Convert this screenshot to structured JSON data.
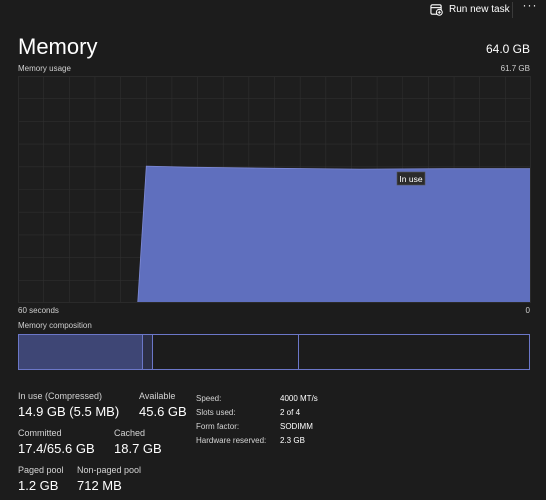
{
  "toolbar": {
    "run_task_label": "Run new task",
    "more_label": "···"
  },
  "header": {
    "title": "Memory",
    "total": "64.0 GB",
    "chart_label": "Memory usage",
    "chart_max": "61.7 GB"
  },
  "chart_data": {
    "type": "area",
    "title": "Memory usage",
    "xlabel": "",
    "ylabel": "",
    "x_range_labels": [
      "60 seconds",
      "0"
    ],
    "ymax_label": "61.7 GB",
    "ylim": [
      0,
      61.7
    ],
    "grid": true,
    "series": [
      {
        "name": "In use",
        "x": [
          60,
          46,
          45,
          40,
          30,
          20,
          10,
          0
        ],
        "values": [
          0,
          0,
          37.2,
          36.9,
          36.6,
          36.4,
          36.5,
          36.5
        ],
        "color": "#5f6fbe"
      }
    ],
    "tooltip": "In use"
  },
  "axis": {
    "left": "60 seconds",
    "right": "0"
  },
  "composition": {
    "label": "Memory composition"
  },
  "stats": {
    "in_use_label": "In use (Compressed)",
    "in_use_value": "14.9 GB (5.5 MB)",
    "available_label": "Available",
    "available_value": "45.6 GB",
    "committed_label": "Committed",
    "committed_value": "17.4/65.6 GB",
    "cached_label": "Cached",
    "cached_value": "18.7 GB",
    "paged_label": "Paged pool",
    "paged_value": "1.2 GB",
    "nonpaged_label": "Non-paged pool",
    "nonpaged_value": "712 MB"
  },
  "specs": [
    {
      "key": "Speed:",
      "value": "4000 MT/s"
    },
    {
      "key": "Slots used:",
      "value": "2 of 4"
    },
    {
      "key": "Form factor:",
      "value": "SODIMM"
    },
    {
      "key": "Hardware reserved:",
      "value": "2.3 GB"
    }
  ],
  "colors": {
    "background": "#1c1c1c",
    "accent": "#5f6fbe",
    "grid": "#2f2f2f"
  }
}
